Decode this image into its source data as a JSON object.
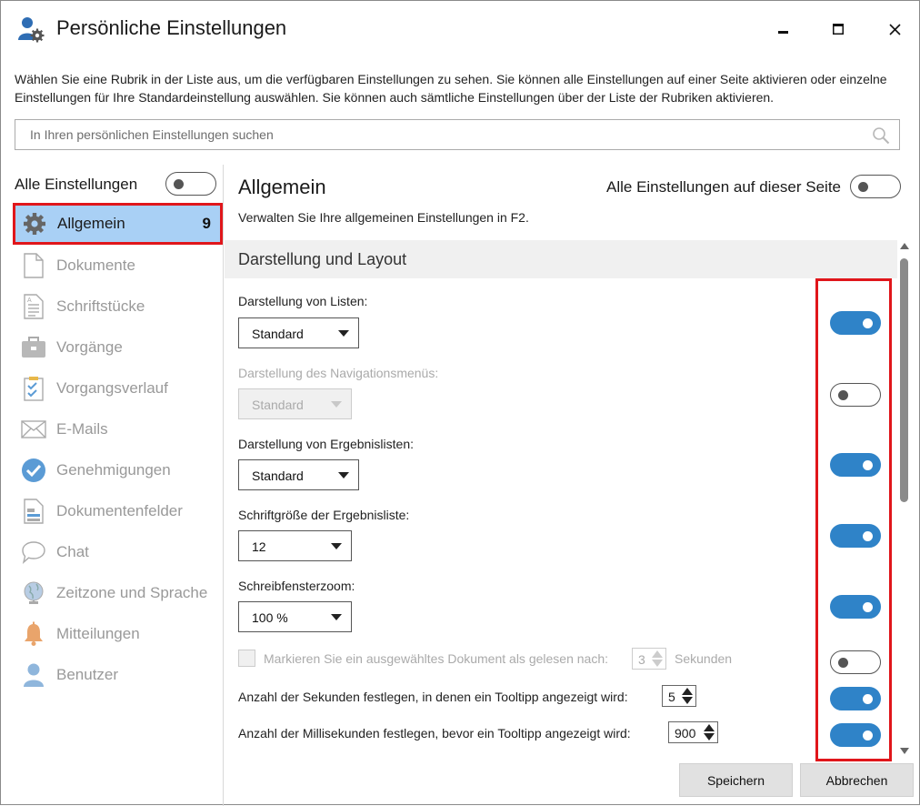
{
  "window": {
    "title": "Persönliche Einstellungen",
    "icons": {
      "app": "user-settings-icon",
      "minimize": "minimize-icon",
      "maximize": "maximize-icon",
      "close": "close-icon"
    }
  },
  "description": "Wählen Sie eine Rubrik in der Liste aus, um die verfügbaren Einstellungen zu sehen. Sie können alle Einstellungen auf einer Seite aktivieren oder einzelne Einstellungen für Ihre Standardeinstellung auswählen. Sie können auch sämtliche Einstellungen über der Liste der Rubriken aktivieren.",
  "search": {
    "placeholder": "In Ihren persönlichen Einstellungen suchen",
    "icon": "search-icon"
  },
  "sidebar": {
    "all_label": "Alle Einstellungen",
    "all_toggle": false,
    "items": [
      {
        "label": "Allgemein",
        "icon": "gear-icon",
        "count": "9",
        "active": true
      },
      {
        "label": "Dokumente",
        "icon": "document-icon"
      },
      {
        "label": "Schriftstücke",
        "icon": "text-document-icon"
      },
      {
        "label": "Vorgänge",
        "icon": "briefcase-icon"
      },
      {
        "label": "Vorgangsverlauf",
        "icon": "clipboard-check-icon"
      },
      {
        "label": "E-Mails",
        "icon": "envelope-icon"
      },
      {
        "label": "Genehmigungen",
        "icon": "check-circle-icon"
      },
      {
        "label": "Dokumentenfelder",
        "icon": "form-fields-icon"
      },
      {
        "label": "Chat",
        "icon": "chat-bubble-icon"
      },
      {
        "label": "Zeitzone und Sprache",
        "icon": "globe-icon"
      },
      {
        "label": "Mitteilungen",
        "icon": "bell-icon"
      },
      {
        "label": "Benutzer",
        "icon": "user-icon"
      }
    ]
  },
  "main": {
    "title": "Allgemein",
    "subtitle": "Verwalten Sie Ihre allgemeinen Einstellungen in F2.",
    "page_all_label": "Alle Einstellungen auf dieser Seite",
    "page_all_toggle": false,
    "section_title": "Darstellung und Layout",
    "settings": [
      {
        "label": "Darstellung von Listen:",
        "value": "Standard",
        "enabled": true,
        "toggle": true
      },
      {
        "label": "Darstellung des Navigationsmenüs:",
        "value": "Standard",
        "enabled": false,
        "toggle": false
      },
      {
        "label": "Darstellung von Ergebnislisten:",
        "value": "Standard",
        "enabled": true,
        "toggle": true
      },
      {
        "label": "Schriftgröße der Ergebnisliste:",
        "value": "12",
        "enabled": true,
        "toggle": true
      },
      {
        "label": "Schreibfensterzoom:",
        "value": "100 %",
        "enabled": true,
        "toggle": true
      }
    ],
    "mark_read": {
      "text_before": "Markieren Sie ein ausgewähltes Dokument als gelesen nach:",
      "value": "3",
      "text_after": "Sekunden",
      "checked": false,
      "enabled": false,
      "toggle": false
    },
    "tooltip_seconds": {
      "text": "Anzahl der Sekunden festlegen, in denen ein Tooltipp angezeigt wird:",
      "value": "5",
      "toggle": true
    },
    "tooltip_ms": {
      "text": "Anzahl der Millisekunden festlegen, bevor ein Tooltipp angezeigt wird:",
      "value": "900",
      "toggle": true
    }
  },
  "buttons": {
    "save": "Speichern",
    "cancel": "Abbrechen"
  },
  "colors": {
    "accent": "#2f83c8",
    "active_bg": "#a9d0f5",
    "highlight": "#e0161b"
  }
}
